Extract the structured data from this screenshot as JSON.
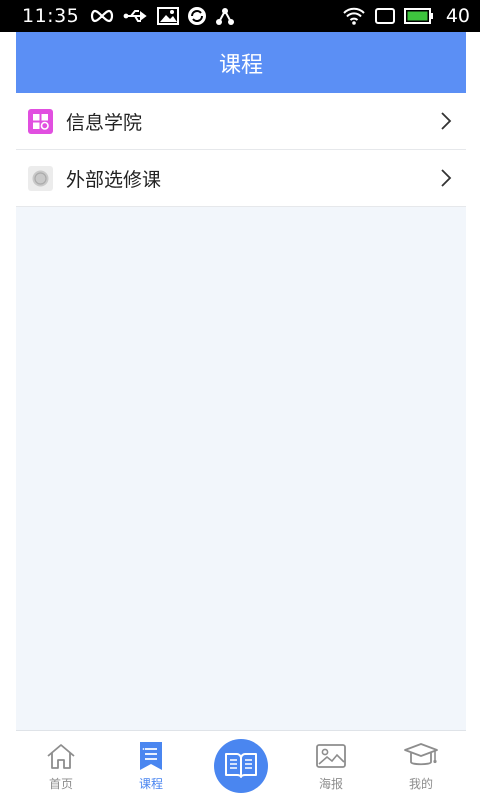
{
  "status_bar": {
    "time": "11:35",
    "battery": "40",
    "icons": [
      "infinity-icon",
      "usb-icon",
      "image-icon",
      "sync-icon",
      "share-icon",
      "wifi-icon",
      "screen-icon",
      "battery-icon"
    ]
  },
  "header": {
    "title": "课程"
  },
  "list": {
    "items": [
      {
        "label": "信息学院",
        "icon": "grid-icon",
        "icon_color": "#e14fe0"
      },
      {
        "label": "外部选修课",
        "icon": "coin-icon",
        "icon_color": "#c9c9c9"
      }
    ]
  },
  "tabbar": {
    "tabs": [
      {
        "label": "首页",
        "icon": "home-icon"
      },
      {
        "label": "课程",
        "icon": "bookmark-list-icon"
      },
      {
        "label": "",
        "icon": "book-icon"
      },
      {
        "label": "海报",
        "icon": "picture-icon"
      },
      {
        "label": "我的",
        "icon": "graduation-cap-icon"
      }
    ],
    "active_index": 1,
    "active_color": "#4a86f0",
    "inactive_color": "#8d8d8d"
  },
  "colors": {
    "header_bg": "#5b8ff5",
    "content_bg": "#f2f6fb"
  }
}
